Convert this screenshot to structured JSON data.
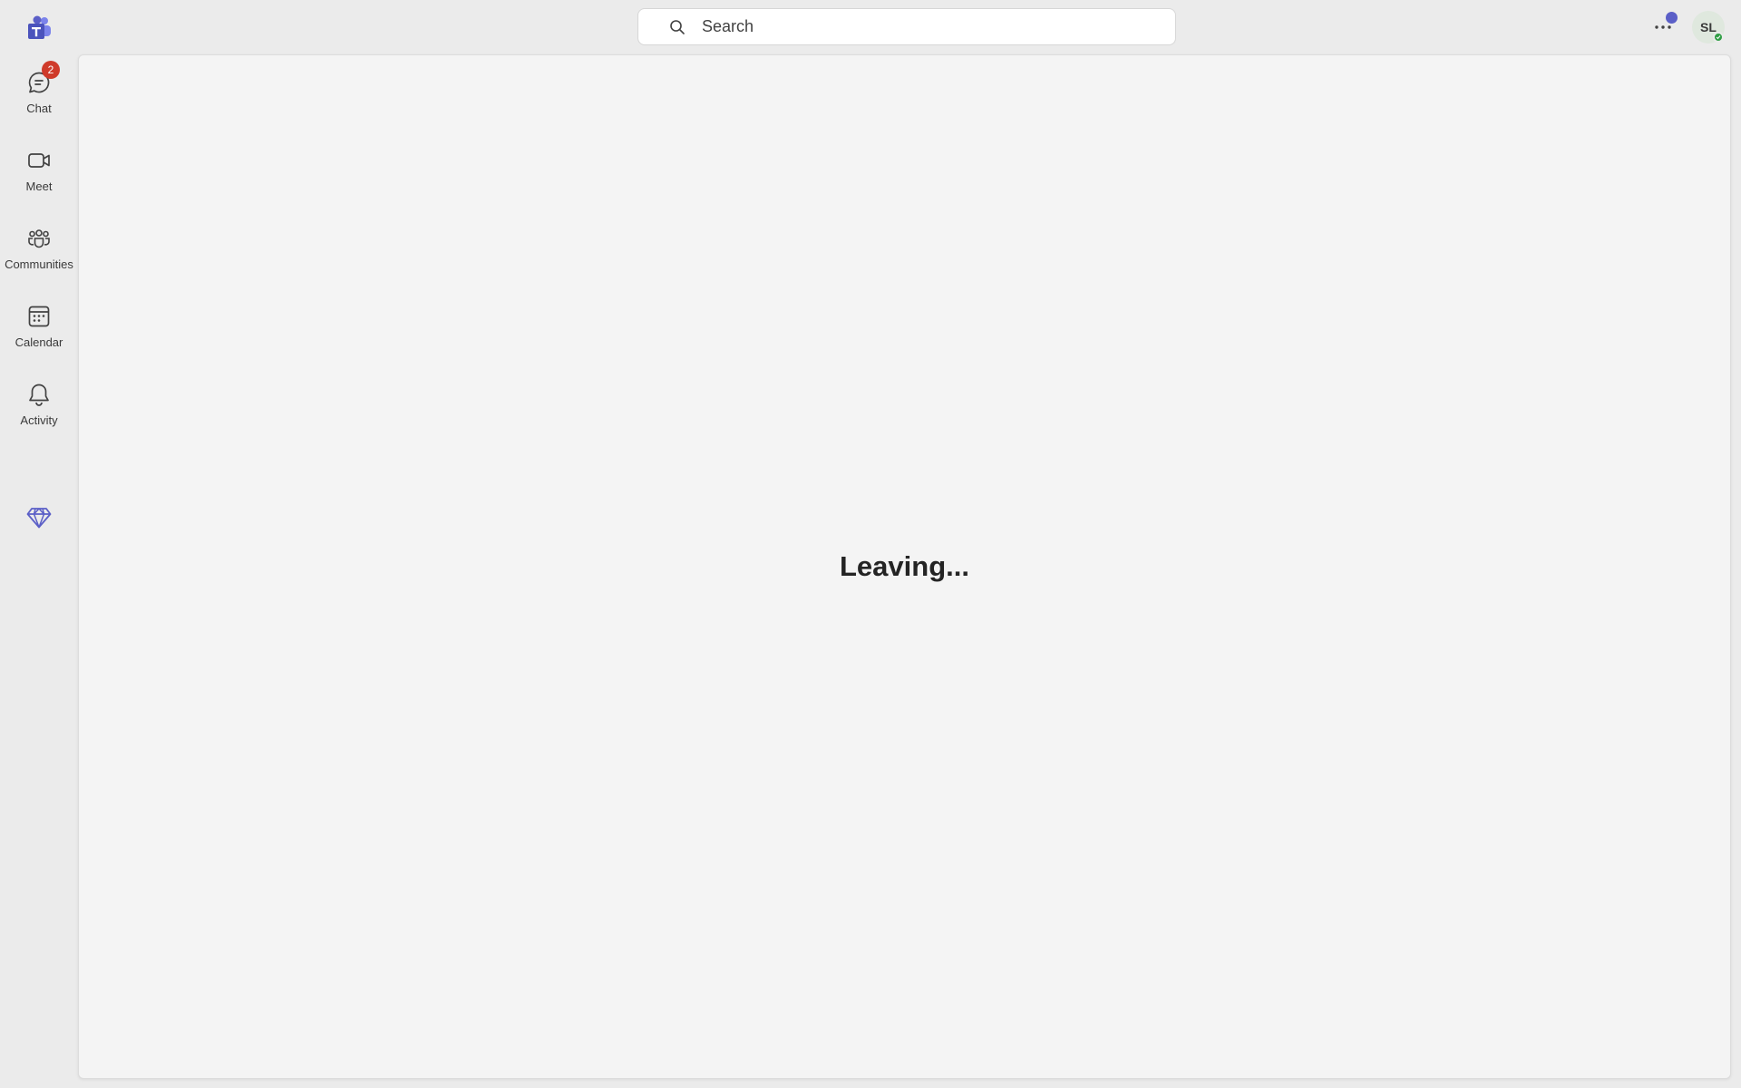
{
  "header": {
    "search": {
      "placeholder": "Search",
      "icon": "search-icon"
    },
    "more_icon": "more-horizontal-icon",
    "notification_dot_color": "#5b5fc7",
    "avatar": {
      "initials": "SL",
      "presence": "available",
      "presence_color": "#2f9e44"
    },
    "logo_icon": "teams-logo-icon",
    "brand_color": "#5b5fc7"
  },
  "sidebar": {
    "items": [
      {
        "label": "Chat",
        "icon": "chat-icon",
        "badge": "2"
      },
      {
        "label": "Meet",
        "icon": "video-camera-icon"
      },
      {
        "label": "Communities",
        "icon": "communities-icon"
      },
      {
        "label": "Calendar",
        "icon": "calendar-icon"
      },
      {
        "label": "Activity",
        "icon": "bell-icon"
      }
    ],
    "premium_icon": "diamond-icon"
  },
  "main": {
    "status": "Leaving..."
  }
}
